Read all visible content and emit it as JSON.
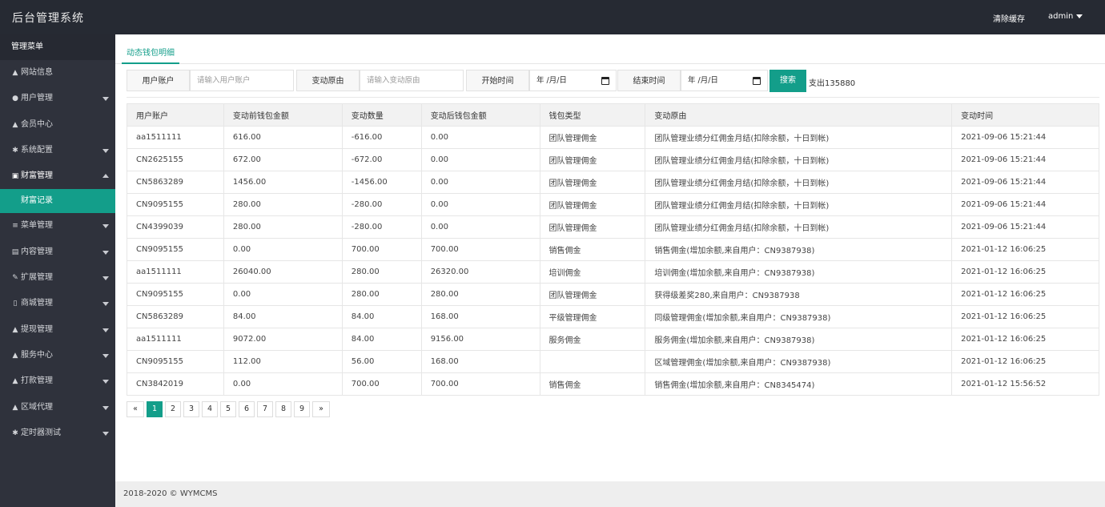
{
  "header": {
    "brand": "后台管理系统",
    "clear_cache": "清除缓存",
    "user": "admin"
  },
  "sidebar": {
    "title": "管理菜单",
    "items": [
      {
        "label": "网站信息",
        "icon": "home-icon",
        "glyph": "▲",
        "has_children": false
      },
      {
        "label": "用户管理",
        "icon": "users-icon",
        "glyph": "●",
        "has_children": true
      },
      {
        "label": "会员中心",
        "icon": "home-icon",
        "glyph": "▲",
        "has_children": false
      },
      {
        "label": "系统配置",
        "icon": "cogs-icon",
        "glyph": "✱",
        "has_children": true
      },
      {
        "label": "财富管理",
        "icon": "money-icon",
        "glyph": "▣",
        "has_children": true,
        "open": true
      },
      {
        "label": "菜单管理",
        "icon": "list-icon",
        "glyph": "≡",
        "has_children": true
      },
      {
        "label": "内容管理",
        "icon": "file-icon",
        "glyph": "▤",
        "has_children": true
      },
      {
        "label": "扩展管理",
        "icon": "wrench-icon",
        "glyph": "✎",
        "has_children": true
      },
      {
        "label": "商城管理",
        "icon": "mobile-icon",
        "glyph": "▯",
        "has_children": true
      },
      {
        "label": "提现管理",
        "icon": "home-icon",
        "glyph": "▲",
        "has_children": true
      },
      {
        "label": "服务中心",
        "icon": "home-icon",
        "glyph": "▲",
        "has_children": true
      },
      {
        "label": "打款管理",
        "icon": "home-icon",
        "glyph": "▲",
        "has_children": true
      },
      {
        "label": "区域代理",
        "icon": "home-icon",
        "glyph": "▲",
        "has_children": true
      },
      {
        "label": "定时器测试",
        "icon": "cogs-icon",
        "glyph": "✱",
        "has_children": true
      }
    ],
    "sub_active": "财富记录"
  },
  "tab": {
    "label": "动态钱包明细"
  },
  "filters": {
    "user_label": "用户账户",
    "user_placeholder": "请输入用户账户",
    "reason_label": "变动原由",
    "reason_placeholder": "请输入变动原由",
    "start_label": "开始时间",
    "start_value": "年 /月/日",
    "end_label": "结束时间",
    "end_value": "年 /月/日",
    "search_label": "搜索",
    "spend_text": "支出135880"
  },
  "table": {
    "columns": [
      "用户账户",
      "变动前钱包金额",
      "变动数量",
      "变动后钱包金额",
      "钱包类型",
      "变动原由",
      "变动时间"
    ],
    "rows": [
      [
        "aa1511111",
        "616.00",
        "-616.00",
        "0.00",
        "团队管理佣金",
        "团队管理业绩分红佣金月结(扣除余额，十日到帐)",
        "2021-09-06 15:21:44"
      ],
      [
        "CN2625155",
        "672.00",
        "-672.00",
        "0.00",
        "团队管理佣金",
        "团队管理业绩分红佣金月结(扣除余额，十日到帐)",
        "2021-09-06 15:21:44"
      ],
      [
        "CN5863289",
        "1456.00",
        "-1456.00",
        "0.00",
        "团队管理佣金",
        "团队管理业绩分红佣金月结(扣除余额，十日到帐)",
        "2021-09-06 15:21:44"
      ],
      [
        "CN9095155",
        "280.00",
        "-280.00",
        "0.00",
        "团队管理佣金",
        "团队管理业绩分红佣金月结(扣除余额，十日到帐)",
        "2021-09-06 15:21:44"
      ],
      [
        "CN4399039",
        "280.00",
        "-280.00",
        "0.00",
        "团队管理佣金",
        "团队管理业绩分红佣金月结(扣除余额，十日到帐)",
        "2021-09-06 15:21:44"
      ],
      [
        "CN9095155",
        "0.00",
        "700.00",
        "700.00",
        "销售佣金",
        "销售佣金(增加余额,来自用户：CN9387938)",
        "2021-01-12 16:06:25"
      ],
      [
        "aa1511111",
        "26040.00",
        "280.00",
        "26320.00",
        "培训佣金",
        "培训佣金(增加余额,来自用户：CN9387938)",
        "2021-01-12 16:06:25"
      ],
      [
        "CN9095155",
        "0.00",
        "280.00",
        "280.00",
        "团队管理佣金",
        "获得级差奖280,来自用户：CN9387938",
        "2021-01-12 16:06:25"
      ],
      [
        "CN5863289",
        "84.00",
        "84.00",
        "168.00",
        "平级管理佣金",
        "同级管理佣金(增加余额,来自用户：CN9387938)",
        "2021-01-12 16:06:25"
      ],
      [
        "aa1511111",
        "9072.00",
        "84.00",
        "9156.00",
        "服务佣金",
        "服务佣金(增加余额,来自用户：CN9387938)",
        "2021-01-12 16:06:25"
      ],
      [
        "CN9095155",
        "112.00",
        "56.00",
        "168.00",
        "",
        "区域管理佣金(增加余额,来自用户：CN9387938)",
        "2021-01-12 16:06:25"
      ],
      [
        "CN3842019",
        "0.00",
        "700.00",
        "700.00",
        "销售佣金",
        "销售佣金(增加余额,来自用户：CN8345474)",
        "2021-01-12 15:56:52"
      ]
    ]
  },
  "pagination": {
    "prev": "«",
    "pages": [
      "1",
      "2",
      "3",
      "4",
      "5",
      "6",
      "7",
      "8",
      "9"
    ],
    "active": "1",
    "next": "»"
  },
  "footer": {
    "text": "2018-2020 © WYMCMS"
  },
  "colors": {
    "accent": "#139e8a",
    "topbar": "#262a33",
    "sidebar": "#2f323c"
  }
}
